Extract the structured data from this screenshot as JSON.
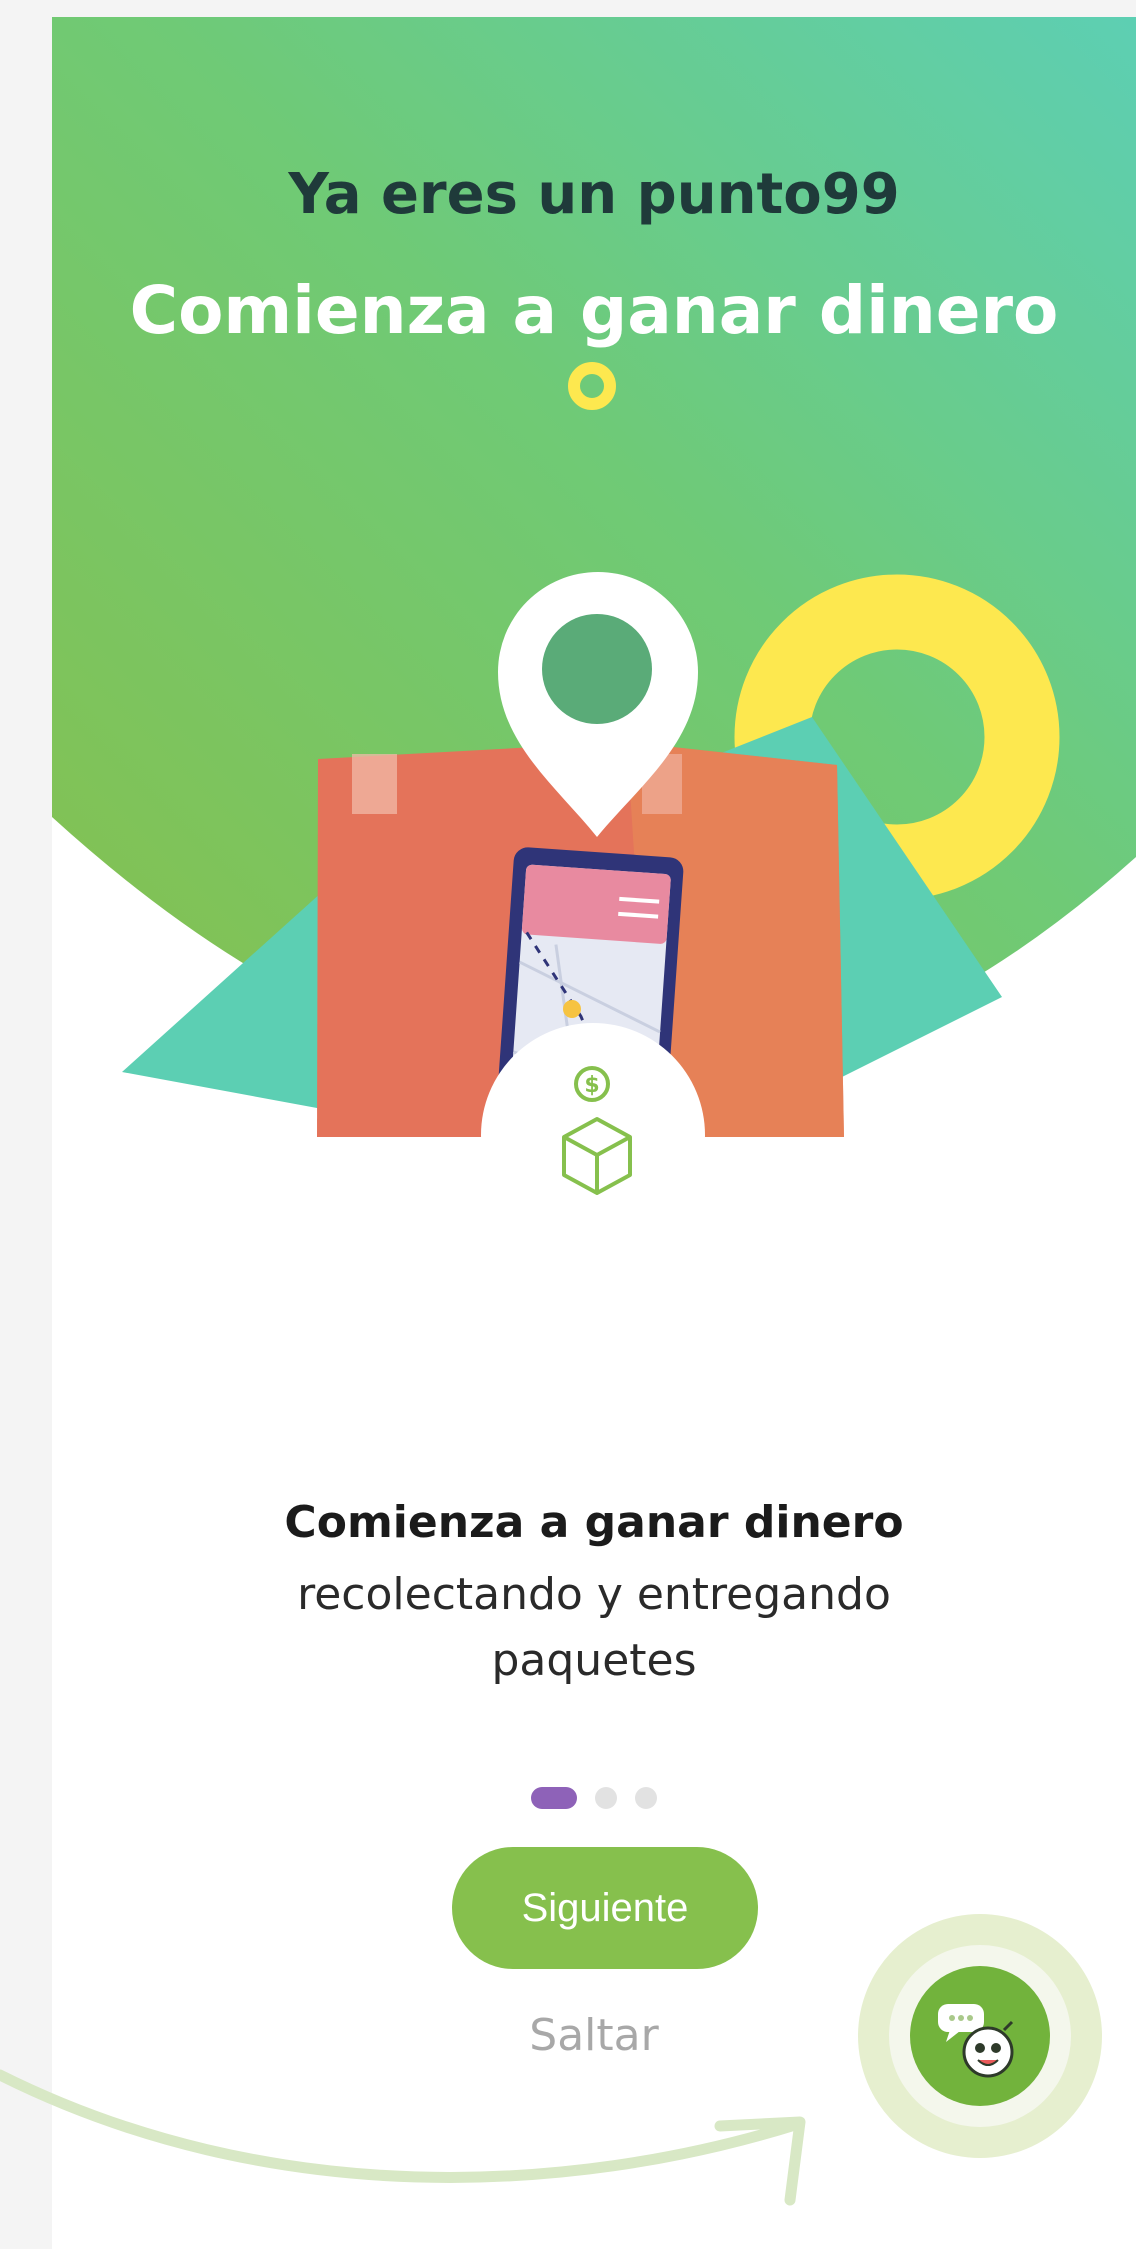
{
  "header": {
    "title": "Ya eres un punto99",
    "subtitle": "Comienza a ganar dinero"
  },
  "body": {
    "headline": "Comienza a ganar dinero",
    "description": "recolectando y entregando paquetes"
  },
  "pagination": {
    "current": 1,
    "total": 3
  },
  "actions": {
    "next_label": "Siguiente",
    "skip_label": "Saltar"
  },
  "icons": {
    "location": "location-pin-icon",
    "money": "dollar-coin-icon",
    "package": "box-icon",
    "chat": "chat-mascot-icon"
  },
  "colors": {
    "primary_green": "#86c04d",
    "teal": "#5ccfb3",
    "yellow": "#fde84f",
    "box_orange": "#e4735a",
    "dot_active": "#8e62b8"
  }
}
